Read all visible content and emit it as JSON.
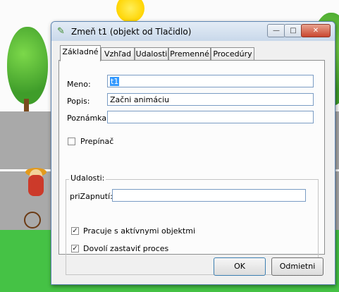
{
  "window": {
    "title": "Zmeň t1 (objekt od Tlačidlo)",
    "title_icon": "clown-icon",
    "controls": {
      "minimize": "—",
      "maximize": "□",
      "close": "✕"
    }
  },
  "tabs": [
    {
      "label": "Základné",
      "active": true
    },
    {
      "label": "Vzhľad"
    },
    {
      "label": "Udalosti"
    },
    {
      "label": "Premenné"
    },
    {
      "label": "Procedúry"
    }
  ],
  "form": {
    "meno_label": "Meno:",
    "meno_value": "t1",
    "popis_label": "Popis:",
    "popis_value": "Začni animáciu",
    "poznamka_label": "Poznámka:",
    "poznamka_value": "",
    "prepinac_label": "Prepínač",
    "prepinac_checked": false
  },
  "events_group": {
    "title": "Udalosti:",
    "prizapnuti_label": "priZapnutí:",
    "prizapnuti_value": "",
    "active_objects_label": "Pracuje s aktívnymi objektmi",
    "active_objects_checked": true,
    "allow_stop_label": "Dovolí zastaviť proces",
    "allow_stop_checked": true
  },
  "buttons": {
    "ok": "OK",
    "cancel": "Odmietni"
  },
  "colors": {
    "road": "#a9a9a9",
    "grass": "#45c245",
    "selection": "#3399ff"
  }
}
